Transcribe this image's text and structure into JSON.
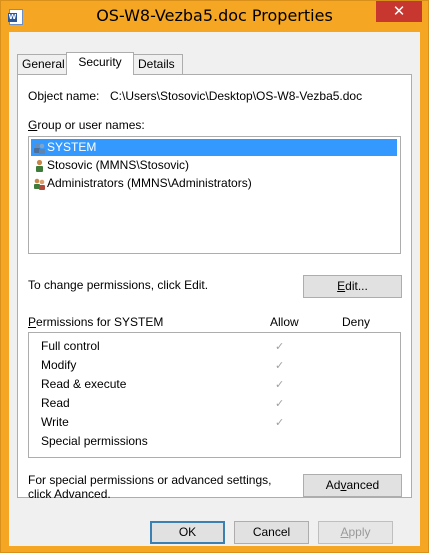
{
  "window": {
    "title": "OS-W8-Vezba5.doc Properties",
    "close_glyph": "✕",
    "icon": "word-document-icon"
  },
  "tabs": [
    {
      "label": "General",
      "active": false
    },
    {
      "label": "Security",
      "active": true
    },
    {
      "label": "Details",
      "active": false
    }
  ],
  "object": {
    "label": "Object name:",
    "value": "C:\\Users\\Stosovic\\Desktop\\OS-W8-Vezba5.doc"
  },
  "groups": {
    "label_first": "G",
    "label_rest": "roup or user names:",
    "items": [
      {
        "label": "SYSTEM",
        "selected": true,
        "icon": "system-users-icon"
      },
      {
        "label": "Stosovic (MMNS\\Stosovic)",
        "selected": false,
        "icon": "user-icon"
      },
      {
        "label": "Administrators (MMNS\\Administrators)",
        "selected": false,
        "icon": "group-icon"
      }
    ]
  },
  "change_perm": {
    "text": "To change permissions, click Edit.",
    "edit_first": "E",
    "edit_rest": "dit..."
  },
  "permissions": {
    "header_first": "P",
    "header_rest": "ermissions for SYSTEM",
    "allow_header": "Allow",
    "deny_header": "Deny",
    "rows": [
      {
        "name": "Full control",
        "allow": "✓"
      },
      {
        "name": "Modify",
        "allow": "✓"
      },
      {
        "name": "Read & execute",
        "allow": "✓"
      },
      {
        "name": "Read",
        "allow": "✓"
      },
      {
        "name": "Write",
        "allow": "✓"
      },
      {
        "name": "Special permissions",
        "allow": ""
      }
    ]
  },
  "advanced": {
    "text_line1": "For special permissions or advanced settings,",
    "text_line2": "click Advanced.",
    "btn_first": "Ad",
    "btn_underline": "v",
    "btn_rest": "anced"
  },
  "footer": {
    "ok": "OK",
    "cancel": "Cancel",
    "apply_first": "A",
    "apply_rest": "pply"
  }
}
